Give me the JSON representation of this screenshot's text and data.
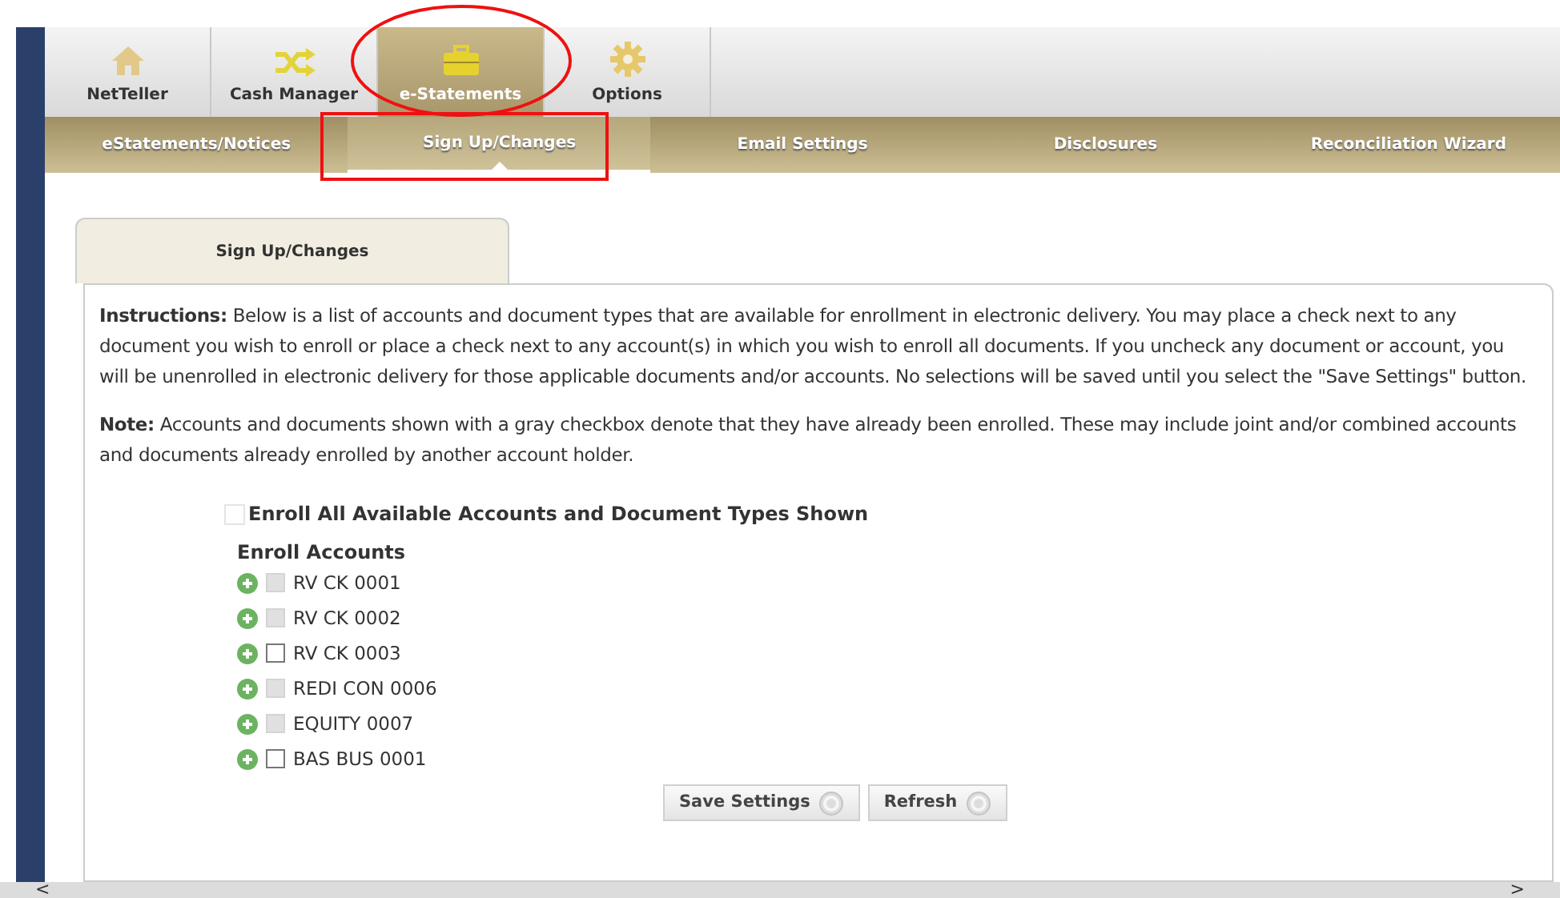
{
  "main_tabs": [
    {
      "label": "NetTeller",
      "selected": false
    },
    {
      "label": "Cash Manager",
      "selected": false
    },
    {
      "label": "e-Statements",
      "selected": true
    },
    {
      "label": "Options",
      "selected": false
    }
  ],
  "sub_tabs": [
    {
      "label": "eStatements/Notices",
      "selected": false
    },
    {
      "label": "Sign Up/Changes",
      "selected": true
    },
    {
      "label": "Email Settings",
      "selected": false
    },
    {
      "label": "Disclosures",
      "selected": false
    },
    {
      "label": "Reconciliation Wizard",
      "selected": false
    }
  ],
  "panel_tab": "Sign Up/Changes",
  "instructions": "**Instructions:** Below is a list of accounts and document types that are available for enrollment in electronic delivery. You may place a check next to any document you wish to enroll or place a check next to any account(s) in which you wish to enroll all documents. If you uncheck any document or account, you will be unenrolled in electronic delivery for those applicable documents and/or accounts. No selections will be saved until you select the \"Save Settings\" button.",
  "note": "**Note:** Accounts and documents shown with a gray checkbox denote that they have already been enrolled. These may include joint and/or combined accounts and documents already enrolled by another account holder.",
  "enroll_all": {
    "label": "Enroll All Available Accounts and Document Types Shown",
    "checked": false
  },
  "accounts_heading": "Enroll Accounts",
  "accounts": [
    {
      "name": "RV CK 0001",
      "enrolled": true
    },
    {
      "name": "RV CK 0002",
      "enrolled": true
    },
    {
      "name": "RV CK 0003",
      "enrolled": false
    },
    {
      "name": "REDI CON 0006",
      "enrolled": true
    },
    {
      "name": "EQUITY 0007",
      "enrolled": true
    },
    {
      "name": "BAS BUS 0001",
      "enrolled": false
    }
  ],
  "buttons": [
    "Save Settings",
    "Refresh"
  ],
  "scrollbar": {
    "left": "<",
    "right": ">"
  }
}
